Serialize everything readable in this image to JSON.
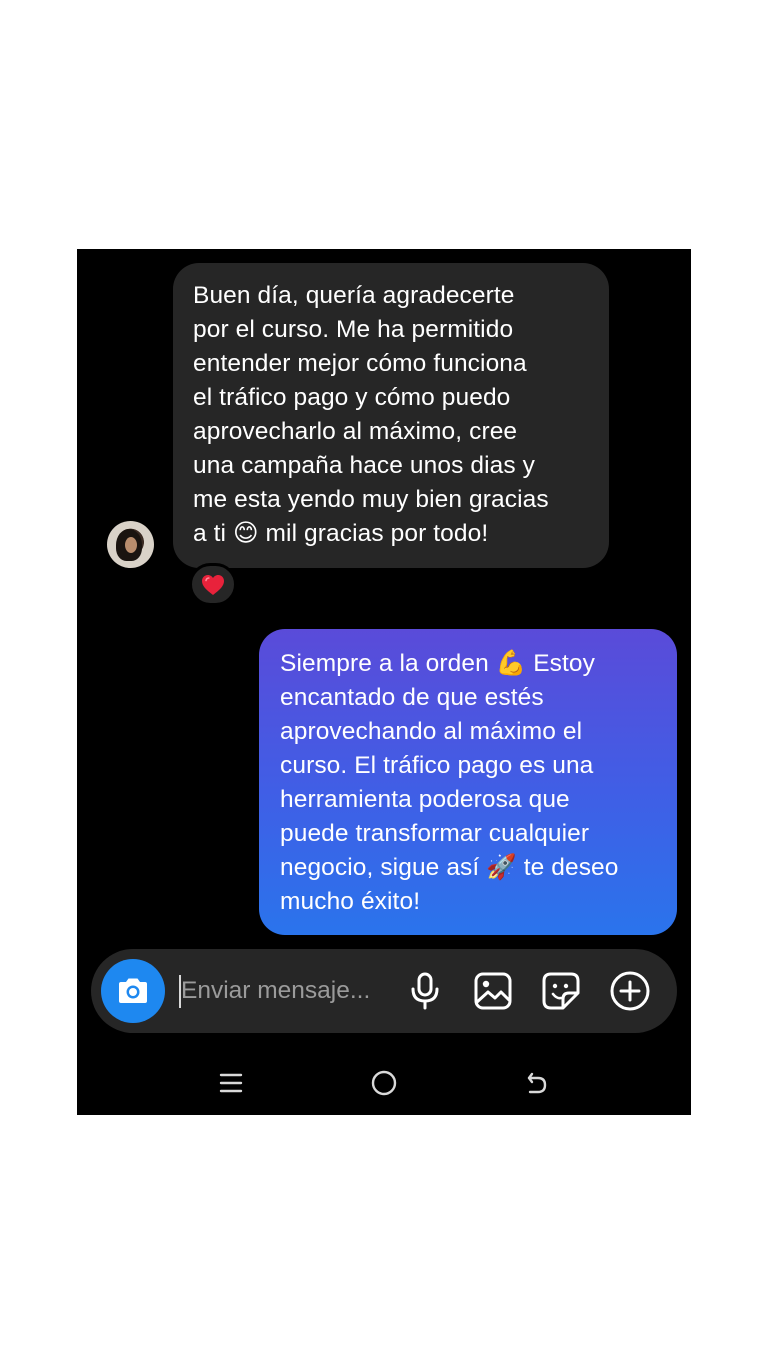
{
  "conversation": {
    "incoming": {
      "text": "Buen día, quería agradecerte\npor el curso. Me ha permitido\nentender mejor cómo funciona\nel tráfico pago y cómo puedo\naprovecharlo al máximo, cree\nuna campaña hace unos dias y\nme esta yendo muy bien gracias\na ti  😊 mil gracias por todo!",
      "reaction": "❤️",
      "avatar_icon": "user-avatar"
    },
    "outgoing": {
      "text": "Siempre a la orden 💪 Estoy\nencantado de que estés\naprovechando al máximo el\ncurso. El tráfico pago es una\nherramienta poderosa que\npuede transformar cualquier\nnegocio, sigue así 🚀 te deseo\nmucho éxito!"
    }
  },
  "composer": {
    "placeholder": "Enviar mensaje...",
    "value": "",
    "icons": [
      "camera-icon",
      "microphone-icon",
      "gallery-icon",
      "sticker-icon",
      "plus-icon"
    ]
  },
  "system_nav": {
    "icons": [
      "recents-icon",
      "home-icon",
      "back-icon"
    ]
  },
  "colors": {
    "screen_background": "#000000",
    "incoming_bubble": "#262626",
    "outgoing_bubble_top": "#5a4bd9",
    "outgoing_bubble_bottom": "#2a74ec",
    "camera_button": "#1e88f0",
    "page_background": "#ffffff"
  }
}
